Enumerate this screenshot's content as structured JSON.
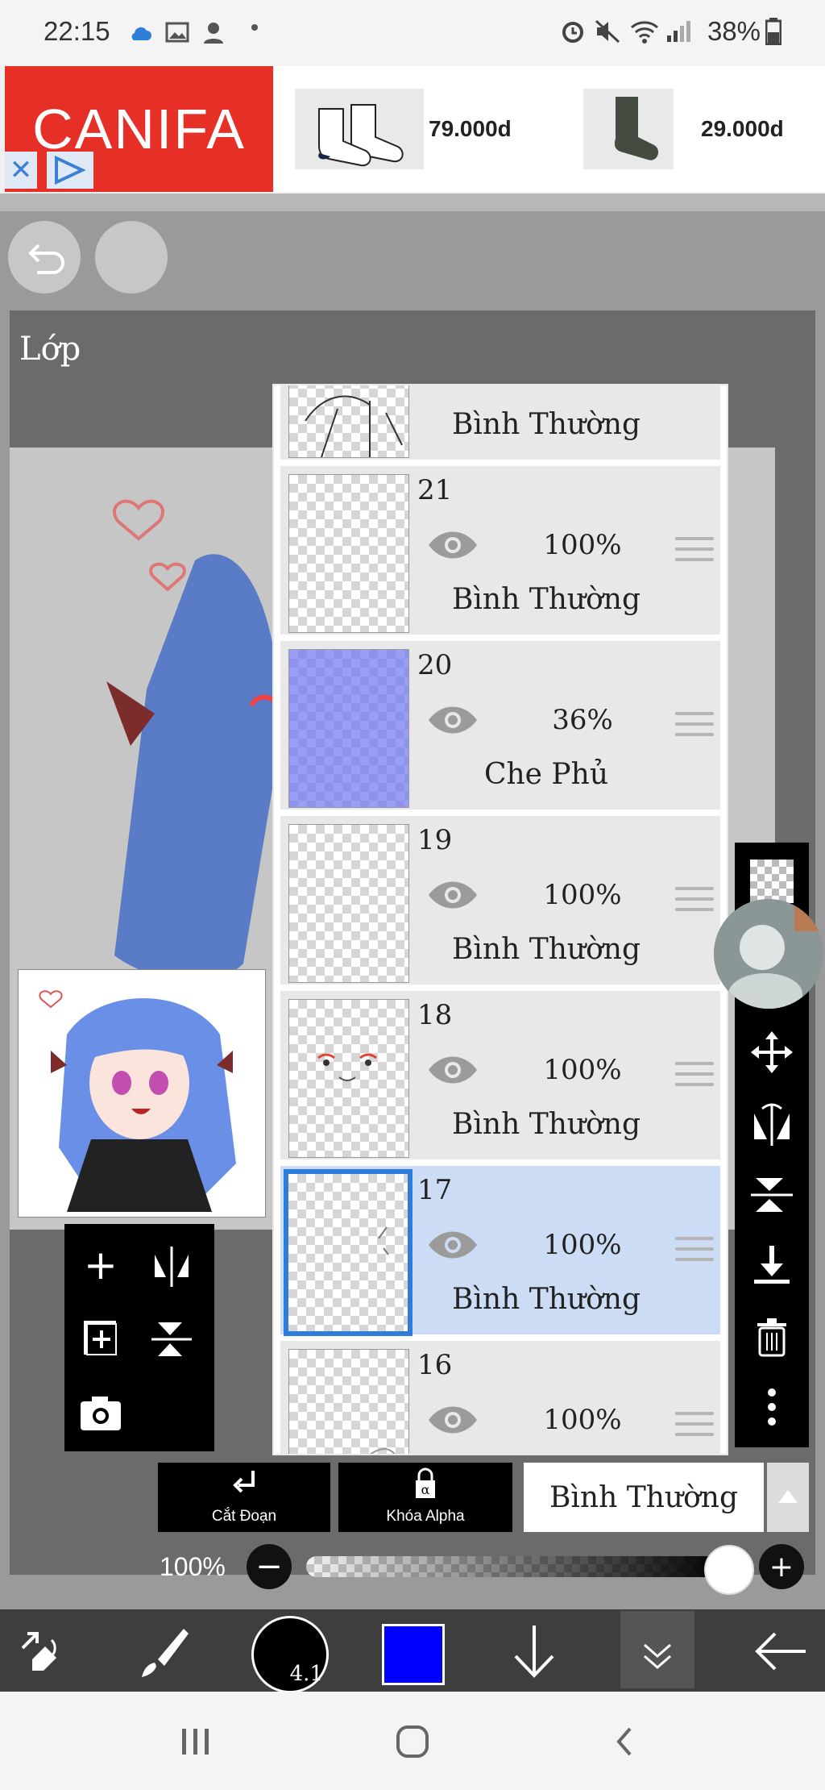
{
  "status_bar": {
    "time": "22:15",
    "battery": "38%"
  },
  "ad": {
    "brand": "CANIFA",
    "products": [
      {
        "name": "sock-pair-white-black",
        "price": "79.000d"
      },
      {
        "name": "sock-dark-green",
        "price": "29.000d"
      }
    ]
  },
  "panel": {
    "title": "Lớp"
  },
  "layers": [
    {
      "number": "",
      "opacity": "",
      "blend": "Bình Thường",
      "partial": true
    },
    {
      "number": "21",
      "opacity": "100%",
      "blend": "Bình Thường"
    },
    {
      "number": "20",
      "opacity": "36%",
      "blend": "Che Phủ"
    },
    {
      "number": "19",
      "opacity": "100%",
      "blend": "Bình Thường"
    },
    {
      "number": "18",
      "opacity": "100%",
      "blend": "Bình Thường"
    },
    {
      "number": "17",
      "opacity": "100%",
      "blend": "Bình Thường",
      "selected": true
    },
    {
      "number": "16",
      "opacity": "100%",
      "blend": ""
    }
  ],
  "actions": {
    "clip_label": "Cắt Đoạn",
    "alpha_lock_label": "Khóa Alpha",
    "blend_mode": "Bình Thường"
  },
  "opacity": {
    "label": "100%",
    "value": 1.0
  },
  "bottom_toolbar": {
    "brush_size": "4.1",
    "color": "#0000ff"
  },
  "colors": {
    "accent": "#2f7ddb",
    "ad_red": "#e63027",
    "selected_row": "#cbdcf4"
  }
}
